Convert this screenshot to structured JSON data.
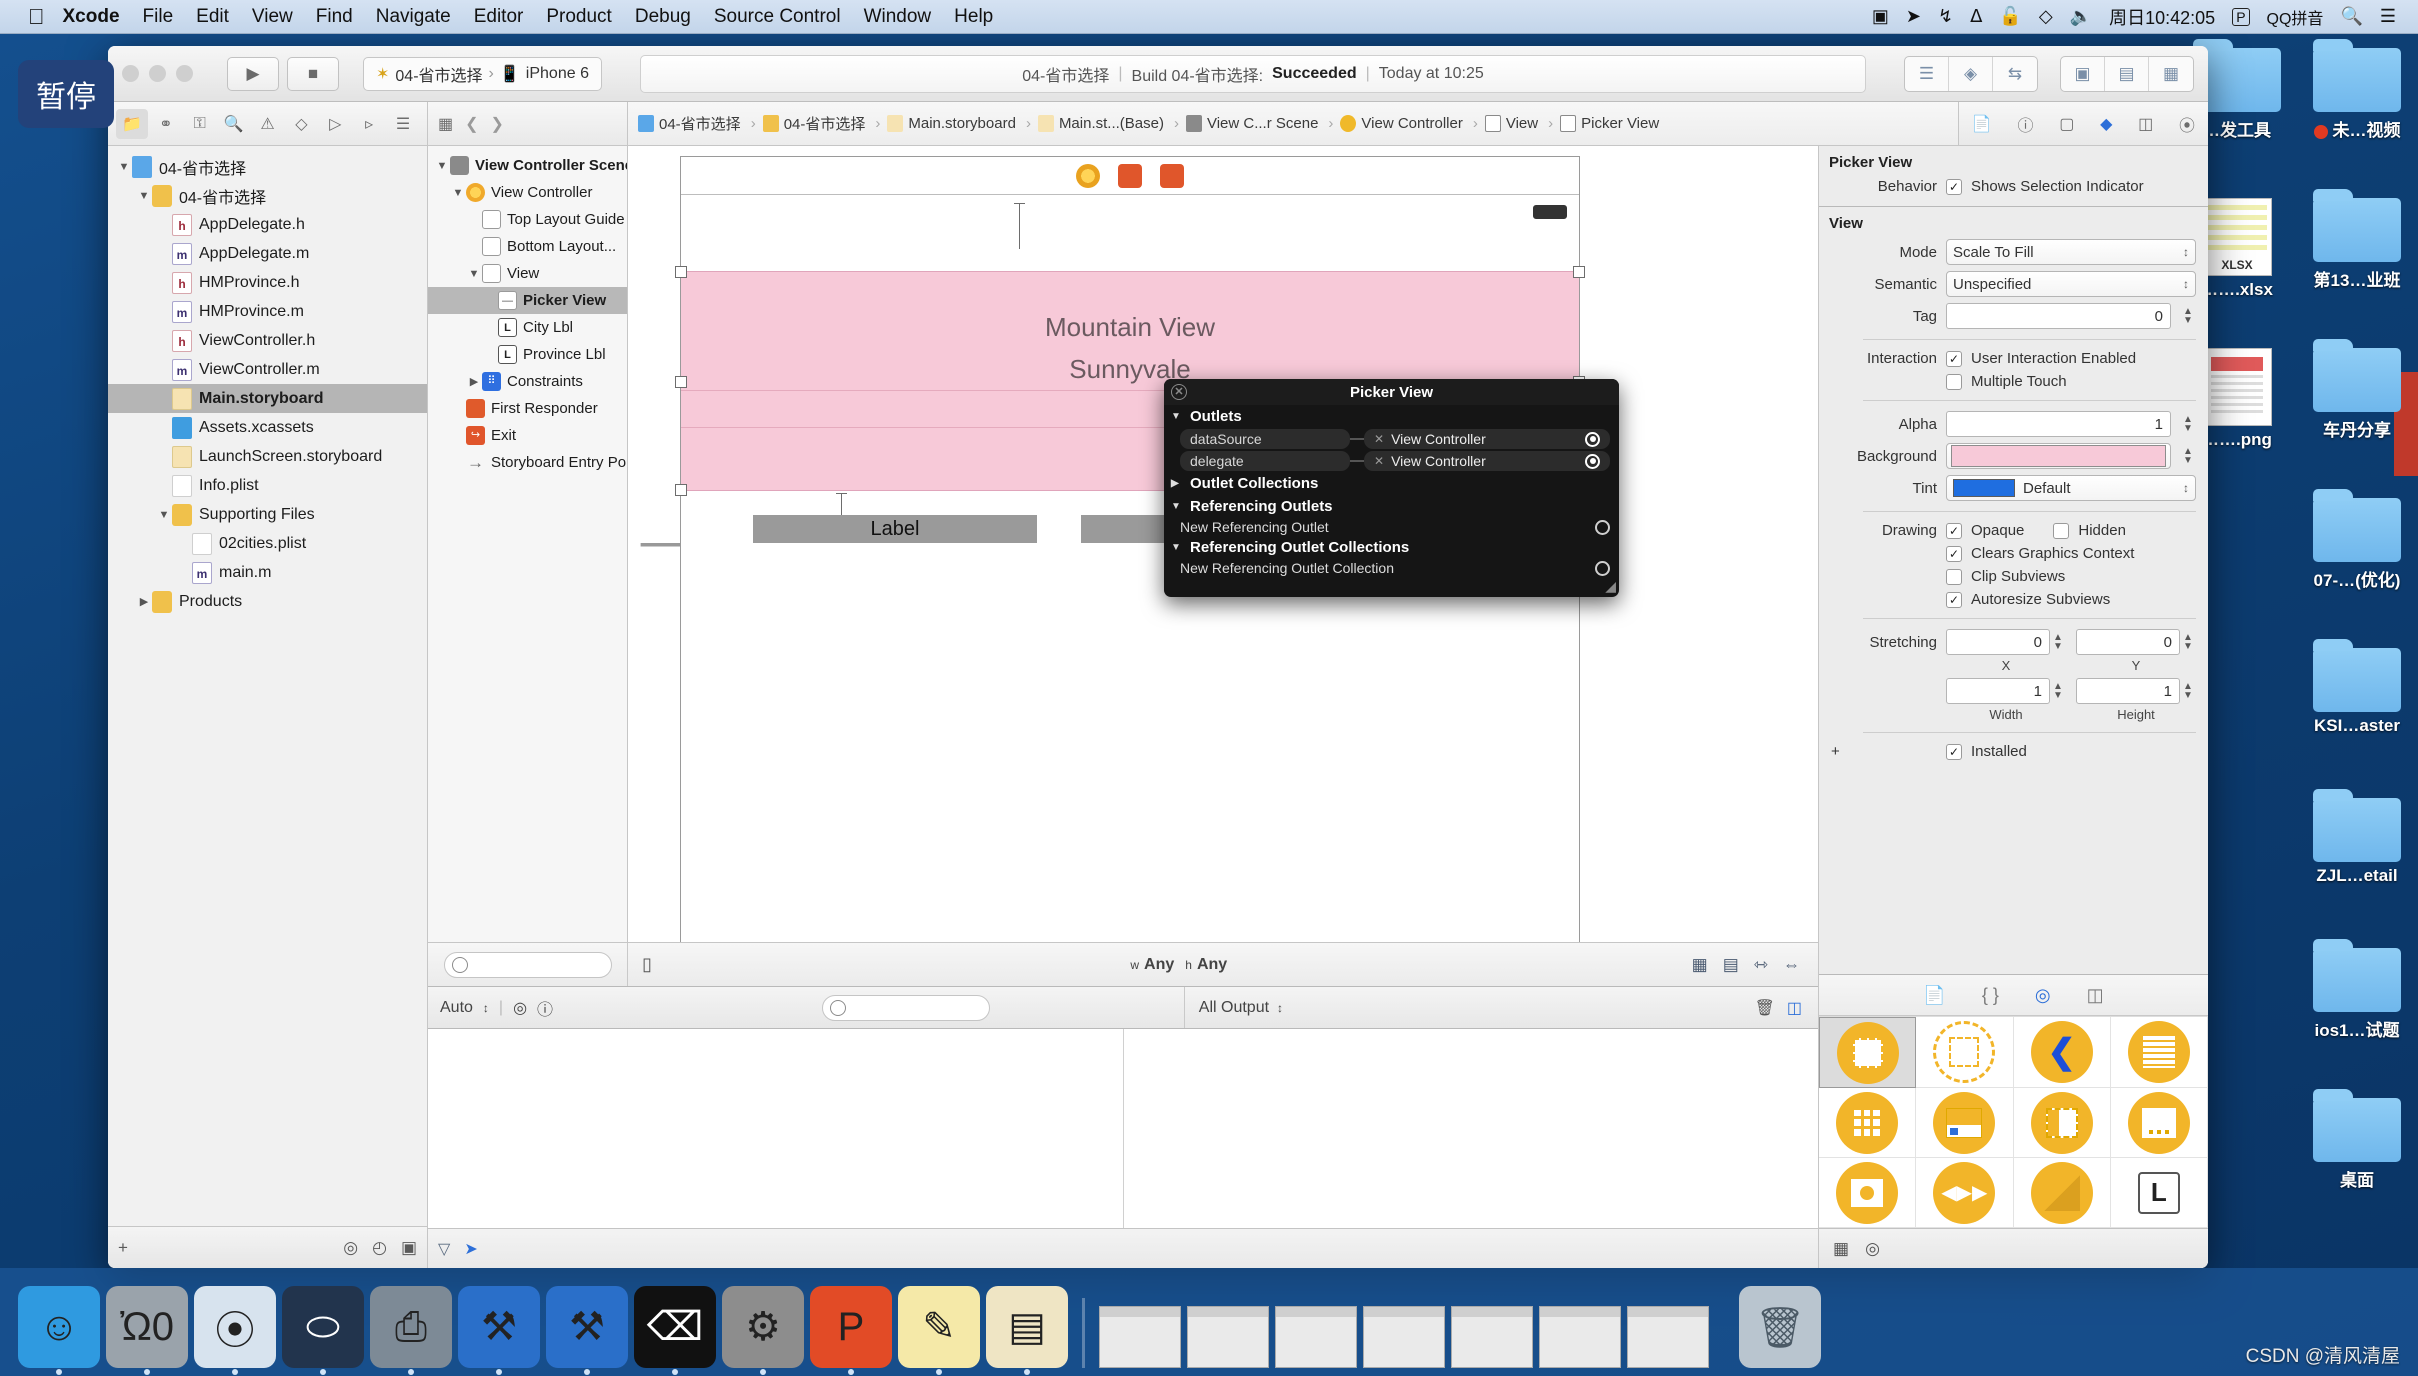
{
  "menubar": {
    "apple": "apple-logo",
    "items": [
      "Xcode",
      "File",
      "Edit",
      "View",
      "Find",
      "Navigate",
      "Editor",
      "Product",
      "Debug",
      "Source Control",
      "Window",
      "Help"
    ],
    "right": {
      "screen_record": "screen-record-icon",
      "location": "location-icon",
      "bluetooth_alt": "airplay-icon",
      "bluetooth": "bluetooth-icon",
      "lock": "lock-icon",
      "dropbox": "dropbox-icon",
      "volume": "volume-icon",
      "clock": "周日10:42:05",
      "input_badge": "P",
      "input_method": "QQ拼音",
      "search": "search-icon",
      "notification": "notification-center-icon"
    }
  },
  "pause_badge": {
    "label": "暂停"
  },
  "xcode": {
    "toolbar": {
      "run_label": "run-icon",
      "stop_label": "stop-icon",
      "scheme_project": "04-省市选择",
      "scheme_sep": "›",
      "scheme_device": "iPhone 6",
      "status": {
        "project": "04-省市选择",
        "sep": "|",
        "build": "Build 04-省市选择:",
        "result": "Succeeded",
        "sep2": "|",
        "time": "Today at 10:25"
      },
      "editor_modes": [
        "standard-editor-icon",
        "assistant-editor-icon",
        "version-editor-icon"
      ],
      "panel_toggles": [
        "navigator-toggle-icon",
        "debug-area-toggle-icon",
        "utilities-toggle-icon"
      ]
    },
    "navigator_filter_icons": [
      "folder-icon",
      "source-control-icon",
      "search-icon",
      "issue-icon",
      "test-icon",
      "debug-icon",
      "breakpoint-icon",
      "report-icon"
    ],
    "outline_bar_icons": [
      "outline-toggle-icon",
      "back-chevron-icon",
      "forward-chevron-icon"
    ],
    "breadcrumb": [
      {
        "icon": "project-icon",
        "label": "04-省市选择"
      },
      {
        "icon": "folder-icon",
        "label": "04-省市选择"
      },
      {
        "icon": "storyboard-icon",
        "label": "Main.storyboard"
      },
      {
        "icon": "storyboard-icon",
        "label": "Main.st...(Base)"
      },
      {
        "icon": "scene-icon",
        "label": "View C...r Scene"
      },
      {
        "icon": "viewcontroller-icon",
        "label": "View Controller"
      },
      {
        "icon": "view-icon",
        "label": "View"
      },
      {
        "icon": "pickerview-icon",
        "label": "Picker View"
      }
    ],
    "inspector_top_icons": [
      "file-inspector-icon",
      "quick-help-icon",
      "identity-inspector-icon",
      "attributes-inspector-icon",
      "size-inspector-icon",
      "connections-inspector-icon"
    ],
    "navigator": {
      "tree": [
        {
          "indent": 0,
          "twisty": "▼",
          "icon": "proj",
          "glyph": "",
          "label": "04-省市选择",
          "selected": false
        },
        {
          "indent": 1,
          "twisty": "▼",
          "icon": "folder",
          "glyph": "",
          "label": "04-省市选择",
          "selected": false
        },
        {
          "indent": 2,
          "twisty": "",
          "icon": "h",
          "glyph": "h",
          "label": "AppDelegate.h",
          "selected": false
        },
        {
          "indent": 2,
          "twisty": "",
          "icon": "m",
          "glyph": "m",
          "label": "AppDelegate.m",
          "selected": false
        },
        {
          "indent": 2,
          "twisty": "",
          "icon": "h",
          "glyph": "h",
          "label": "HMProvince.h",
          "selected": false
        },
        {
          "indent": 2,
          "twisty": "",
          "icon": "m",
          "glyph": "m",
          "label": "HMProvince.m",
          "selected": false
        },
        {
          "indent": 2,
          "twisty": "",
          "icon": "h",
          "glyph": "h",
          "label": "ViewController.h",
          "selected": false
        },
        {
          "indent": 2,
          "twisty": "",
          "icon": "m",
          "glyph": "m",
          "label": "ViewController.m",
          "selected": false
        },
        {
          "indent": 2,
          "twisty": "",
          "icon": "sb",
          "glyph": "",
          "label": "Main.storyboard",
          "selected": true
        },
        {
          "indent": 2,
          "twisty": "",
          "icon": "xcassets",
          "glyph": "",
          "label": "Assets.xcassets",
          "selected": false
        },
        {
          "indent": 2,
          "twisty": "",
          "icon": "sb",
          "glyph": "",
          "label": "LaunchScreen.storyboard",
          "selected": false
        },
        {
          "indent": 2,
          "twisty": "",
          "icon": "plist",
          "glyph": "",
          "label": "Info.plist",
          "selected": false
        },
        {
          "indent": 2,
          "twisty": "▼",
          "icon": "folder",
          "glyph": "",
          "label": "Supporting Files",
          "selected": false
        },
        {
          "indent": 3,
          "twisty": "",
          "icon": "plist",
          "glyph": "",
          "label": "02cities.plist",
          "selected": false
        },
        {
          "indent": 3,
          "twisty": "",
          "icon": "m",
          "glyph": "m",
          "label": "main.m",
          "selected": false
        },
        {
          "indent": 1,
          "twisty": "▶",
          "icon": "folder",
          "glyph": "",
          "label": "Products",
          "selected": false
        }
      ],
      "bottom_bar": [
        "add-icon",
        "filter-icon",
        "recent-files-icon",
        "source-control-filter-icon"
      ]
    },
    "document_outline": [
      {
        "indent": 0,
        "twisty": "▼",
        "icon": "scene",
        "glyph": "",
        "label": "View Controller Scene",
        "selected": false,
        "bold": true
      },
      {
        "indent": 1,
        "twisty": "▼",
        "icon": "vc",
        "glyph": "",
        "label": "View Controller",
        "selected": false
      },
      {
        "indent": 2,
        "twisty": "",
        "icon": "guide",
        "glyph": "",
        "label": "Top Layout Guide",
        "selected": false
      },
      {
        "indent": 2,
        "twisty": "",
        "icon": "guide",
        "glyph": "",
        "label": "Bottom Layout...",
        "selected": false
      },
      {
        "indent": 2,
        "twisty": "▼",
        "icon": "view",
        "glyph": "",
        "label": "View",
        "selected": false
      },
      {
        "indent": 3,
        "twisty": "",
        "icon": "picker",
        "glyph": "—",
        "label": "Picker View",
        "selected": true
      },
      {
        "indent": 3,
        "twisty": "",
        "icon": "lbl",
        "glyph": "L",
        "label": "City Lbl",
        "selected": false
      },
      {
        "indent": 3,
        "twisty": "",
        "icon": "lbl",
        "glyph": "L",
        "label": "Province Lbl",
        "selected": false
      },
      {
        "indent": 2,
        "twisty": "▶",
        "icon": "cons",
        "glyph": "⠿",
        "label": "Constraints",
        "selected": false
      },
      {
        "indent": 1,
        "twisty": "",
        "icon": "fr",
        "glyph": "",
        "label": "First Responder",
        "selected": false
      },
      {
        "indent": 1,
        "twisty": "",
        "icon": "exit",
        "glyph": "↪",
        "label": "Exit",
        "selected": false
      },
      {
        "indent": 1,
        "twisty": "",
        "icon": "entry",
        "glyph": "→",
        "label": "Storyboard Entry Point",
        "selected": false
      }
    ],
    "canvas": {
      "picker_rows": [
        "Mountain View",
        "Sunnyvale"
      ],
      "labels": [
        "Label",
        "Label"
      ],
      "background_color": "#f7c9d8",
      "bottom_bar": {
        "zoom_placeholder": "",
        "device_icon": "device-icon",
        "size_class_w_prefix": "w",
        "size_class_w": "Any",
        "size_class_h_prefix": "h",
        "size_class_h": "Any",
        "right_icons": [
          "update-frames-icon",
          "embed-in-icon",
          "align-icon",
          "pin-icon"
        ]
      }
    },
    "popover": {
      "title": "Picker View",
      "close": "close-icon",
      "groups": [
        {
          "twisty": "▼",
          "title": "Outlets",
          "rows": [
            {
              "name": "dataSource",
              "target": "View Controller",
              "connected": true
            },
            {
              "name": "delegate",
              "target": "View Controller",
              "connected": true
            }
          ]
        },
        {
          "twisty": "▶",
          "title": "Outlet Collections",
          "rows": []
        },
        {
          "twisty": "▼",
          "title": "Referencing Outlets",
          "subrows": [
            {
              "name": "New Referencing Outlet",
              "connected": false
            }
          ]
        },
        {
          "twisty": "▼",
          "title": "Referencing Outlet Collections",
          "subrows": [
            {
              "name": "New Referencing Outlet Collection",
              "connected": false
            }
          ]
        }
      ]
    },
    "debug_toolbar": {
      "auto_label": "Auto",
      "left_icons": [
        "eye-icon",
        "info-icon"
      ],
      "console_filter_placeholder": "",
      "output_label": "All Output",
      "trash_icon": "trash-icon",
      "split_icon": "split-console-icon"
    },
    "inspector": {
      "picker_section": {
        "title": "Picker View",
        "behavior_label": "Behavior",
        "shows_selection_indicator": {
          "label": "Shows Selection Indicator",
          "checked": true
        }
      },
      "view_section": {
        "title": "View",
        "mode": {
          "label": "Mode",
          "value": "Scale To Fill"
        },
        "semantic": {
          "label": "Semantic",
          "value": "Unspecified"
        },
        "tag": {
          "label": "Tag",
          "value": "0"
        },
        "interaction": {
          "label": "Interaction",
          "user_interaction_enabled": {
            "label": "User Interaction Enabled",
            "checked": true
          },
          "multiple_touch": {
            "label": "Multiple Touch",
            "checked": false
          }
        },
        "alpha": {
          "label": "Alpha",
          "value": "1"
        },
        "background": {
          "label": "Background",
          "color": "#f7c9d8"
        },
        "tint": {
          "label": "Tint",
          "value": "Default",
          "color": "#1f6ee0"
        },
        "drawing": {
          "label": "Drawing",
          "opaque": {
            "label": "Opaque",
            "checked": true
          },
          "hidden": {
            "label": "Hidden",
            "checked": false
          },
          "clears_graphics_context": {
            "label": "Clears Graphics Context",
            "checked": true
          },
          "clip_subviews": {
            "label": "Clip Subviews",
            "checked": false
          },
          "autoresize_subviews": {
            "label": "Autoresize Subviews",
            "checked": true
          }
        },
        "stretching": {
          "label": "Stretching",
          "x": {
            "value": "0",
            "caption": "X"
          },
          "y": {
            "value": "0",
            "caption": "Y"
          },
          "width": {
            "value": "1",
            "caption": "Width"
          },
          "height": {
            "value": "1",
            "caption": "Height"
          }
        },
        "installed": {
          "label": "Installed",
          "checked": true,
          "plus": "+"
        }
      }
    },
    "library": {
      "tabs": [
        "file-template-library-icon",
        "code-snippet-library-icon",
        "object-library-icon",
        "media-library-icon"
      ],
      "selected_tab_index": 2,
      "items": [
        {
          "name": "view-object",
          "glyph": "view",
          "selected": true
        },
        {
          "name": "custom-view-object",
          "glyph": "dashed",
          "selected": false
        },
        {
          "name": "navigation-back-object",
          "glyph": "chevron",
          "selected": false
        },
        {
          "name": "table-view-object",
          "glyph": "lines",
          "selected": false
        },
        {
          "name": "collection-view-object",
          "glyph": "grid",
          "selected": false
        },
        {
          "name": "search-bar-object",
          "glyph": "searchbar",
          "selected": false
        },
        {
          "name": "split-view-object",
          "glyph": "split",
          "selected": false
        },
        {
          "name": "page-control-object",
          "glyph": "pagecontrol",
          "selected": false
        },
        {
          "name": "image-view-object",
          "glyph": "image",
          "selected": false
        },
        {
          "name": "player-object",
          "glyph": "player",
          "selected": false
        },
        {
          "name": "scene-kit-object",
          "glyph": "cube",
          "selected": false
        },
        {
          "name": "label-object",
          "glyph": "L",
          "selected": false
        }
      ],
      "bottom_icons": [
        "library-list-icon",
        "library-filter-icon"
      ]
    }
  },
  "desktop": {
    "icons": [
      {
        "type": "folder",
        "label": "…发工具",
        "col": 0,
        "row": 0,
        "dot": false
      },
      {
        "type": "folder",
        "label": "未…视频",
        "col": 1,
        "row": 0,
        "dot": true
      },
      {
        "type": "xlsx",
        "label": "…….xlsx",
        "badge": "XLSX",
        "col": 0,
        "row": 1,
        "dot": false
      },
      {
        "type": "folder",
        "label": "第13…业班",
        "col": 1,
        "row": 1,
        "dot": false
      },
      {
        "type": "png",
        "label": "…….png",
        "col": 0,
        "row": 2,
        "dot": false
      },
      {
        "type": "folder",
        "label": "车丹分享",
        "col": 1,
        "row": 2,
        "dot": false
      },
      {
        "type": "folder",
        "label": "07-…(优化)",
        "col": 1,
        "row": 3,
        "dot": false
      },
      {
        "type": "folder",
        "label": "KSI…aster",
        "col": 1,
        "row": 4,
        "dot": false
      },
      {
        "type": "folder",
        "label": "ZJL…etail",
        "col": 1,
        "row": 5,
        "dot": false
      },
      {
        "type": "folder",
        "label": "ios1…试题",
        "col": 1,
        "row": 6,
        "dot": false
      },
      {
        "type": "folder",
        "label": "桌面",
        "col": 1,
        "row": 7,
        "dot": false
      }
    ]
  },
  "dock": {
    "items": [
      {
        "name": "finder",
        "glyph": "☺"
      },
      {
        "name": "launchpad",
        "glyph": "Ὠ0"
      },
      {
        "name": "safari",
        "glyph": "⦿"
      },
      {
        "name": "mouse-app",
        "glyph": "⬭"
      },
      {
        "name": "imovie",
        "glyph": "⎙"
      },
      {
        "name": "xcode",
        "glyph": "⚒"
      },
      {
        "name": "xcode-beta",
        "glyph": "⚒"
      },
      {
        "name": "terminal",
        "glyph": "⌫"
      },
      {
        "name": "system-preferences",
        "glyph": "⚙"
      },
      {
        "name": "pdf-expert",
        "glyph": "P"
      },
      {
        "name": "notes",
        "glyph": "✎"
      },
      {
        "name": "dash",
        "glyph": "▤"
      }
    ],
    "windows": [
      "w1",
      "w2",
      "w3",
      "w4",
      "w5",
      "w6",
      "w7"
    ],
    "trash": "trash-icon"
  },
  "watermark": "CSDN @清风清屋"
}
